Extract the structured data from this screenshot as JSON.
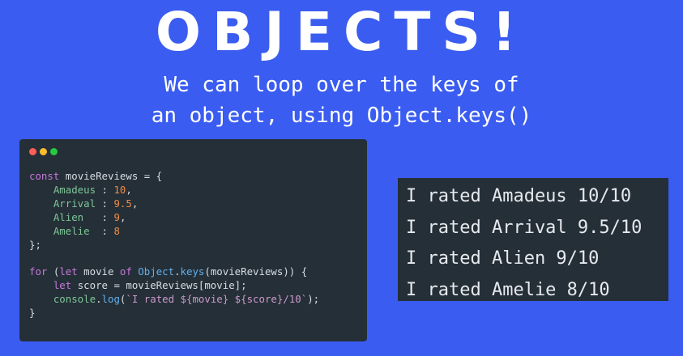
{
  "slide": {
    "title": "OBJECTS!",
    "subtitle_line1": "We can loop over the keys of",
    "subtitle_line2": "an object, using Object.keys()"
  },
  "code": {
    "l1_kw": "const",
    "l1_rest": " movieReviews = {",
    "entries": [
      {
        "key": "Amadeus",
        "pad": " : ",
        "value": "10",
        "end": ","
      },
      {
        "key": "Arrival",
        "pad": " : ",
        "value": "9.5",
        "end": ","
      },
      {
        "key": "Alien",
        "pad": "   : ",
        "value": "9",
        "end": ","
      },
      {
        "key": "Amelie",
        "pad": "  : ",
        "value": "8",
        "end": ""
      }
    ],
    "close_obj": "};",
    "for_kw": "for",
    "for_open": " (",
    "let_kw": "let",
    "for_mid": " movie ",
    "of_kw": "of",
    "for_obj": " Object",
    "for_dot": ".",
    "keys_fn": "keys",
    "for_tail": "(movieReviews)) {",
    "let2_kw": "let",
    "score_rest": " score = movieReviews[movie];",
    "console_obj": "console",
    "console_dot": ".",
    "log_fn": "log",
    "log_open": "(",
    "template_str": "`I rated ${movie} ${score}/10`",
    "log_close": ");",
    "close_for": "}"
  },
  "output": {
    "lines": [
      "I rated Amadeus 10/10",
      "I rated Arrival 9.5/10",
      "I rated Alien 9/10",
      "I rated Amelie 8/10"
    ]
  }
}
